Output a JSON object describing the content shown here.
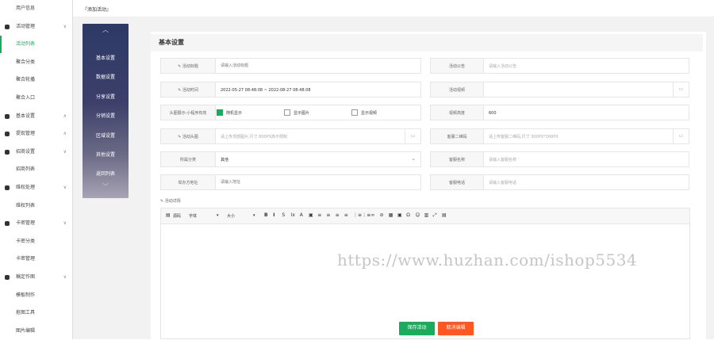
{
  "breadcrumb": "『添加活动』",
  "sidebar": [
    {
      "label": "用户信息",
      "type": "sub",
      "active": false
    },
    {
      "label": "活动管理",
      "type": "group",
      "chev": "∨"
    },
    {
      "label": "活动列表",
      "type": "sub",
      "active": true
    },
    {
      "label": "聚合分类",
      "type": "sub",
      "active": false
    },
    {
      "label": "聚合轮播",
      "type": "sub",
      "active": false
    },
    {
      "label": "聚合入口",
      "type": "sub",
      "active": false
    },
    {
      "label": "基本设置",
      "type": "group",
      "chev": "∧"
    },
    {
      "label": "提现管理",
      "type": "group",
      "chev": "∧"
    },
    {
      "label": "招商设置",
      "type": "group",
      "chev": "∨"
    },
    {
      "label": "招商列表",
      "type": "sub",
      "active": false
    },
    {
      "label": "维权处理",
      "type": "group",
      "chev": "∨"
    },
    {
      "label": "维权列表",
      "type": "sub",
      "active": false
    },
    {
      "label": "卡密管理",
      "type": "group",
      "chev": "∨"
    },
    {
      "label": "卡密分类",
      "type": "sub",
      "active": false
    },
    {
      "label": "卡密管理",
      "type": "sub",
      "active": false
    },
    {
      "label": "稿定作图",
      "type": "group",
      "chev": "∨"
    },
    {
      "label": "模板制作",
      "type": "sub",
      "active": false
    },
    {
      "label": "抠图工具",
      "type": "sub",
      "active": false
    },
    {
      "label": "图片编辑",
      "type": "sub",
      "active": false
    }
  ],
  "nav": {
    "up": "︿",
    "down": "﹀",
    "items": [
      "基本设置",
      "数据设置",
      "分享设置",
      "分销设置",
      "区域设置",
      "其他设置",
      "返回列表"
    ]
  },
  "section_title": "基本设置",
  "left_fields": [
    {
      "label": "活动标题",
      "icon": true,
      "value": "",
      "placeholder": "请输入活动标题"
    },
    {
      "label": "活动时间",
      "icon": true,
      "value": "2022-05-27 08:48:08 ~ 2022-08-27 08:48:08",
      "placeholder": ""
    }
  ],
  "display_row": {
    "label": "头图展示-小程序有效",
    "options": [
      {
        "text": "随机显示",
        "checked": true
      },
      {
        "text": "显示图片",
        "checked": false
      },
      {
        "text": "显示视频",
        "checked": false
      }
    ]
  },
  "head_image": {
    "label": "活动头图",
    "placeholder": "请上传顶部图片,尺寸 800PX高不限制"
  },
  "category": {
    "label": "所属分类",
    "value": "其他",
    "arrow": "⌄"
  },
  "org_address": {
    "label": "举办方地址",
    "placeholder": "请输入地址"
  },
  "right_fields": [
    {
      "label": "活动公告",
      "placeholder": "请输入活动公告",
      "value": "",
      "upload": false
    },
    {
      "label": "活动视频",
      "placeholder": "",
      "value": "",
      "upload": true
    },
    {
      "label": "视频高度",
      "placeholder": "",
      "value": "600",
      "upload": false
    },
    {
      "label": "客服二维码",
      "placeholder": "请上传客服二维码,尺寸 300PX*300PX",
      "value": "",
      "upload": true
    },
    {
      "label": "客服名称",
      "placeholder": "请输入客服名称",
      "value": "",
      "upload": false
    },
    {
      "label": "客服电话",
      "placeholder": "请输入客服电话",
      "value": "",
      "upload": false
    }
  ],
  "detail_label": "活动详情",
  "editor": {
    "source": "源码",
    "font": "字体",
    "size": "大小",
    "tools": [
      "B",
      "I",
      "S",
      "Ix",
      "A",
      "▣",
      "≡",
      "≡",
      "≡",
      "≡",
      "⋮≡",
      "⋮≡",
      "∞",
      "⊘",
      "▦",
      "▣",
      "Ω",
      "☺",
      "▥",
      "⤢",
      "▤"
    ]
  },
  "buttons": {
    "save": "保存活动",
    "cancel": "取消编辑"
  },
  "watermark": "https://www.huzhan.com/ishop5534",
  "colors": {
    "accent": "#1aab5c",
    "cancel": "#ff5722"
  }
}
